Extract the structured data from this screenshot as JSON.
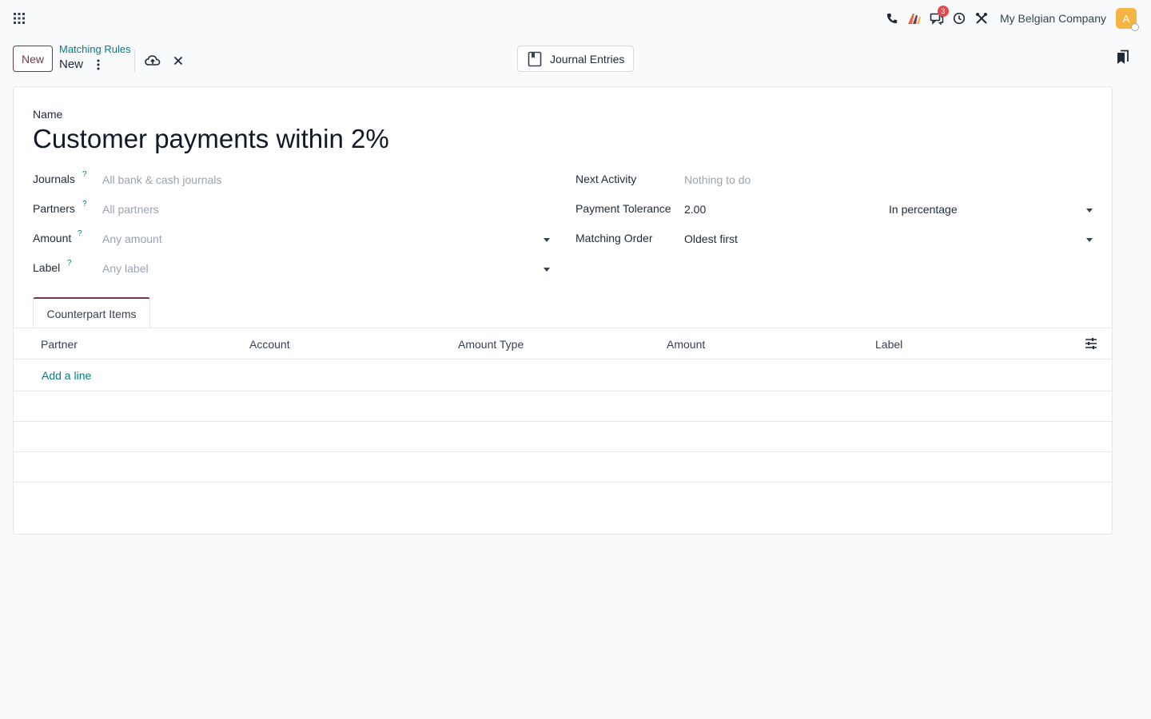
{
  "navbar": {
    "company": "My Belgian Company",
    "avatar_initial": "A",
    "messages_badge": "3",
    "icons": [
      "apps-icon",
      "phone-icon",
      "ai-icon",
      "chat-icon",
      "clock-icon",
      "tools-icon"
    ],
    "accent_color": "#71394f",
    "link_color": "#017e84",
    "badge_color": "#e34a4a",
    "avatar_color": "#f5b544"
  },
  "control_panel": {
    "new_button": "New",
    "breadcrumb_parent": "Matching Rules",
    "breadcrumb_current": "New",
    "smart_button": "Journal Entries"
  },
  "form": {
    "name_label": "Name",
    "name_value": "Customer payments within 2%",
    "help_mark": "?",
    "journals": {
      "label": "Journals",
      "placeholder": "All bank & cash journals"
    },
    "partners": {
      "label": "Partners",
      "placeholder": "All partners"
    },
    "amount": {
      "label": "Amount",
      "placeholder": "Any amount"
    },
    "label_field": {
      "label": "Label",
      "placeholder": "Any label"
    },
    "next_activity": {
      "label": "Next Activity",
      "placeholder": "Nothing to do"
    },
    "payment_tolerance": {
      "label": "Payment Tolerance",
      "value": "2.00",
      "type": "In percentage"
    },
    "matching_order": {
      "label": "Matching Order",
      "value": "Oldest first"
    }
  },
  "tabs": [
    {
      "label": "Counterpart Items",
      "active": true
    }
  ],
  "table": {
    "columns": [
      "Partner",
      "Account",
      "Amount Type",
      "Amount",
      "Label"
    ],
    "add_line": "Add a line",
    "rows": []
  }
}
